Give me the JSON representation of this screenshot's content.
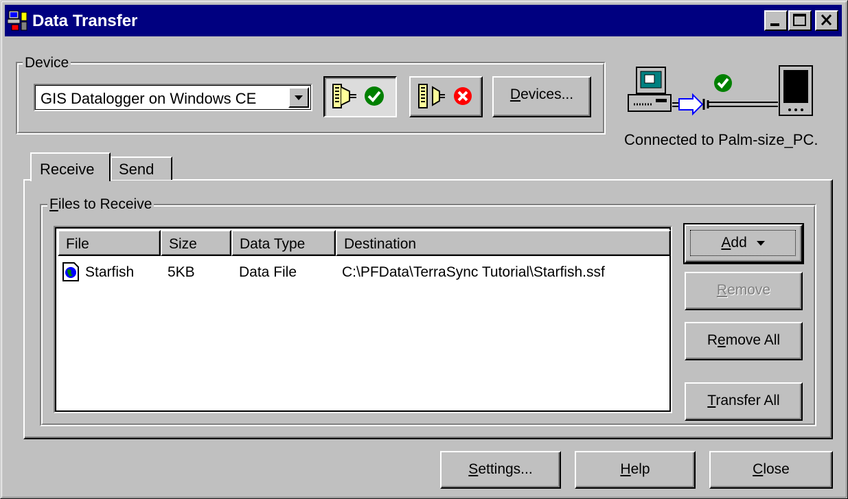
{
  "window": {
    "title": "Data Transfer"
  },
  "device": {
    "group_label": "Device",
    "selected": "GIS Datalogger on Windows CE",
    "devices_button_pre": "",
    "devices_button_ul": "D",
    "devices_button_post": "evices..."
  },
  "status": {
    "text": "Connected to Palm-size_PC."
  },
  "tabs": [
    {
      "label": "Receive"
    },
    {
      "label": "Send"
    }
  ],
  "files": {
    "group_label_ul": "F",
    "group_label_post": "iles to Receive",
    "columns": [
      "File",
      "Size",
      "Data Type",
      "Destination"
    ],
    "rows": [
      {
        "file": "Starfish",
        "size": "5KB",
        "type": "Data File",
        "destination": "C:\\PFData\\TerraSync Tutorial\\Starfish.ssf"
      }
    ]
  },
  "side_buttons": {
    "add_ul": "A",
    "add_post": "dd",
    "remove_ul": "R",
    "remove_post": "emove",
    "remove_all_pre": "R",
    "remove_all_ul": "e",
    "remove_all_post": "move All",
    "transfer_all_ul": "T",
    "transfer_all_post": "ransfer All"
  },
  "bottom_buttons": {
    "settings_ul": "S",
    "settings_post": "ettings...",
    "help_ul": "H",
    "help_post": "elp",
    "close_ul": "C",
    "close_post": "lose"
  },
  "colors": {
    "titlebar": "#000080",
    "face": "#c0c0c0",
    "ok_green": "#008000",
    "err_red": "#ff0000"
  }
}
